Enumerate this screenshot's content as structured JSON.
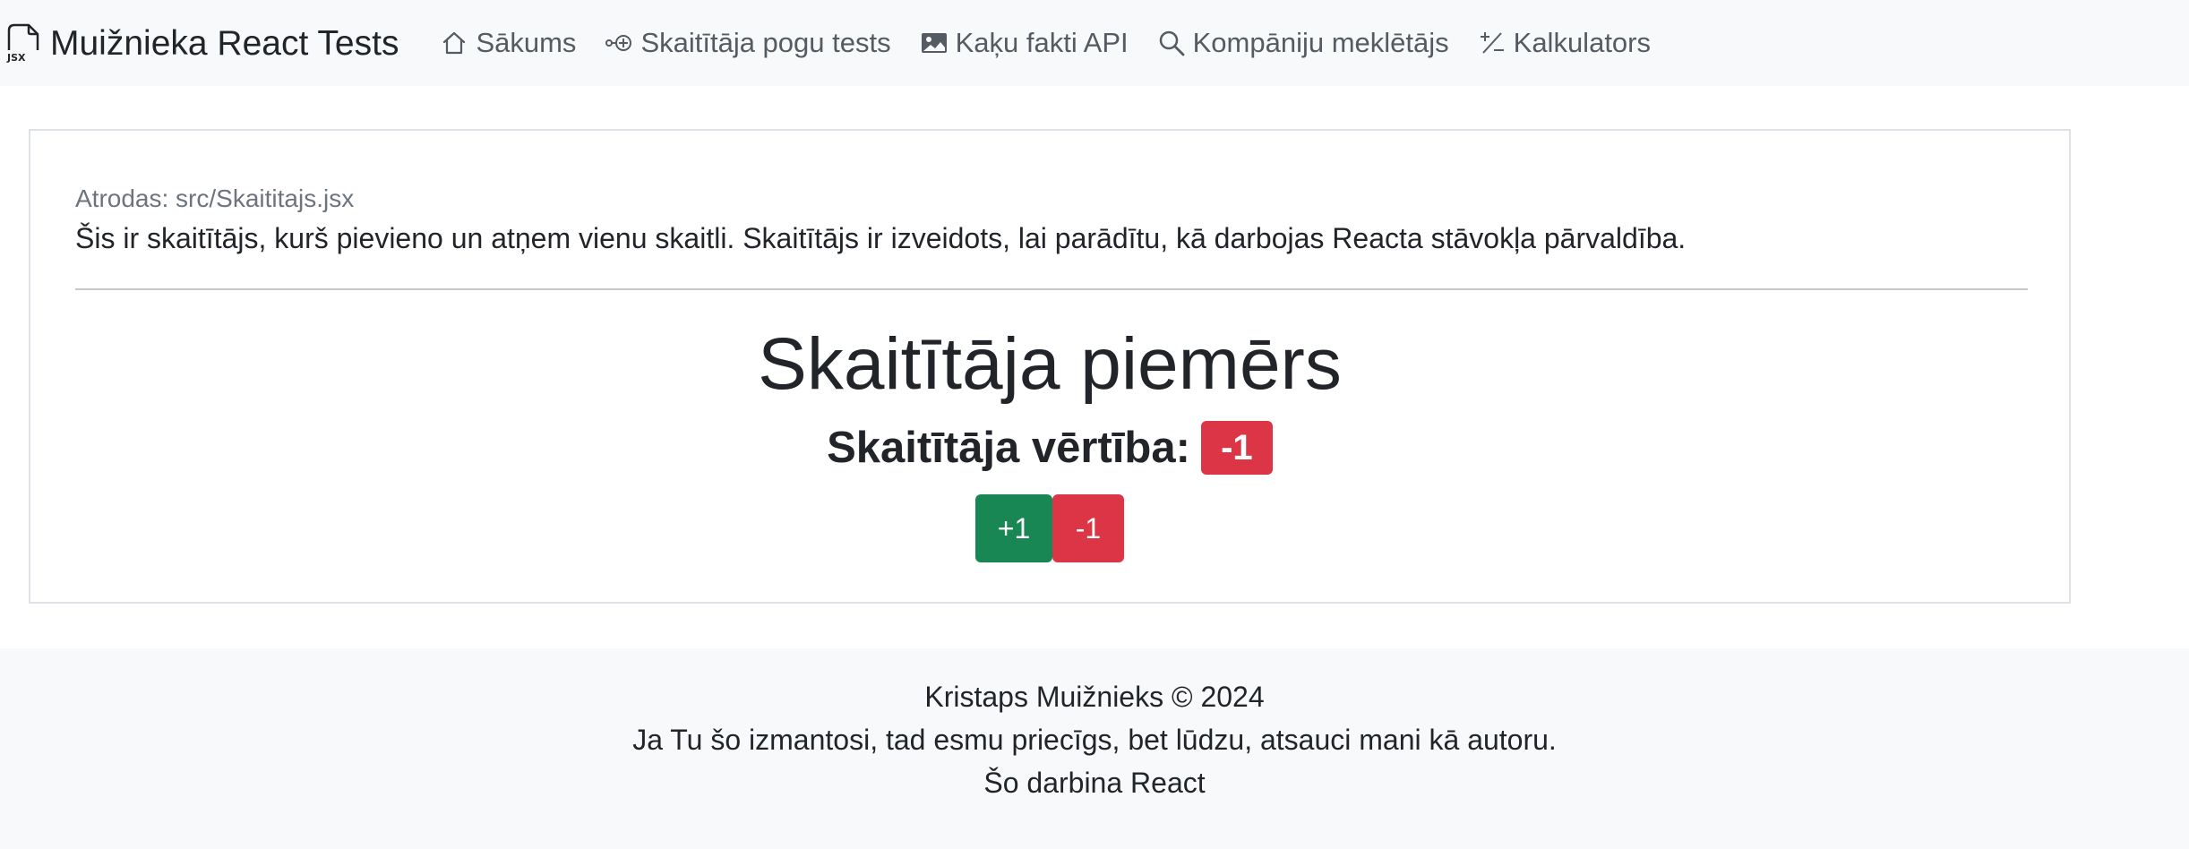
{
  "navbar": {
    "brand_text": "Muižnieka React Tests",
    "brand_icon": "file-jsx-icon",
    "links": [
      {
        "label": "Sākums",
        "icon": "house-icon"
      },
      {
        "label": "Skaitītāja pogu tests",
        "icon": "key-plus-icon"
      },
      {
        "label": "Kaķu fakti API",
        "icon": "image-icon"
      },
      {
        "label": "Kompāniju meklētājs",
        "icon": "search-icon"
      },
      {
        "label": "Kalkulators",
        "icon": "plus-slash-minus-icon"
      }
    ]
  },
  "main": {
    "location": "Atrodas: src/Skaititajs.jsx",
    "description": "Šis ir skaitītājs, kurš pievieno un atņem vienu skaitli. Skaitītājs ir izveidots, lai parādītu, kā darbojas Reacta stāvokļa pārvaldība.",
    "title": "Skaitītāja piemērs",
    "value_label": "Skaitītāja vērtība:",
    "value": "-1",
    "value_color": "#dc3545",
    "increment_label": "+1",
    "increment_color": "#198754",
    "decrement_label": "-1",
    "decrement_color": "#dc3545"
  },
  "footer": {
    "line1": "Kristaps Muižnieks © 2024",
    "line2": "Ja Tu šo izmantosi, tad esmu priecīgs, bet lūdzu, atsauci mani kā autoru.",
    "line3": "Šo darbina React"
  }
}
